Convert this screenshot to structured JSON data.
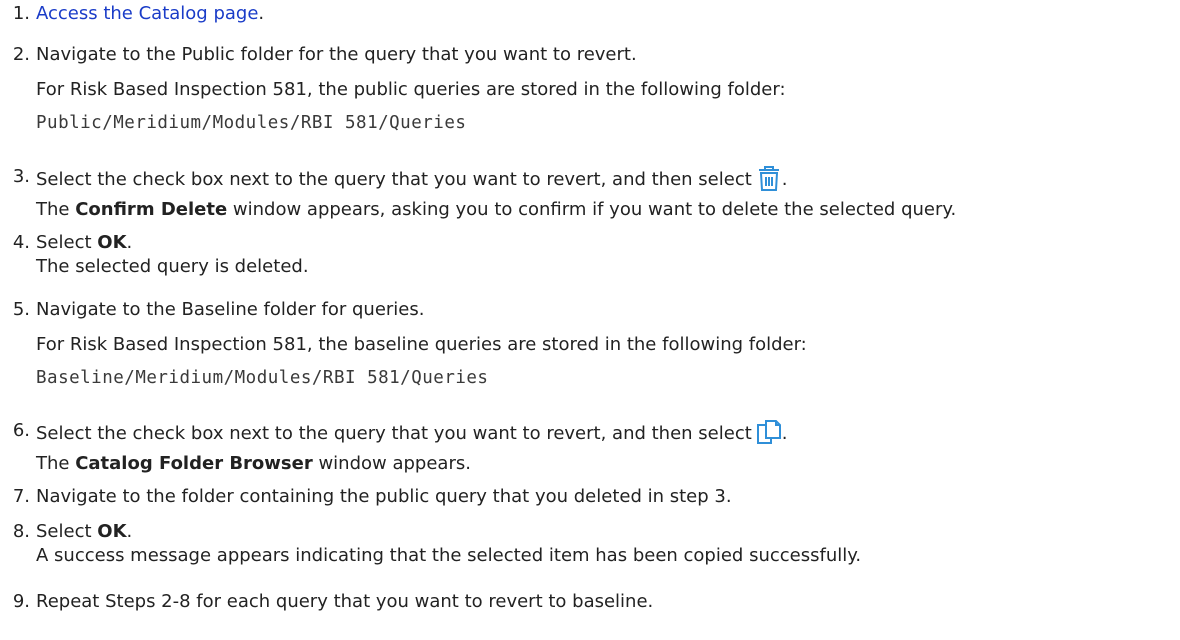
{
  "steps": [
    {
      "num": "1.",
      "link_text": "Access the Catalog page",
      "suffix": "."
    },
    {
      "num": "2.",
      "text": "Navigate to the Public folder for the query that you want to revert.",
      "note": "For Risk Based Inspection 581, the public queries are stored in the following folder:",
      "path": "Public/Meridium/Modules/RBI 581/Queries"
    },
    {
      "num": "3.",
      "text": "Select the check box next to the query that you want to revert, and then select",
      "icon": "trash-icon",
      "result_pre": "The ",
      "result_bold": "Confirm Delete",
      "result_post": " window appears, asking you to confirm if you want to delete the selected query."
    },
    {
      "num": "4.",
      "pre": "Select ",
      "bold": "OK",
      "post": ".",
      "result": "The selected query is deleted."
    },
    {
      "num": "5.",
      "text": "Navigate to the Baseline folder for queries.",
      "note": "For Risk Based Inspection 581, the baseline queries are stored in the following folder:",
      "path": "Baseline/Meridium/Modules/RBI 581/Queries"
    },
    {
      "num": "6.",
      "text": "Select the check box next to the query that you want to revert, and then select",
      "icon": "copy-icon",
      "result_pre": "The ",
      "result_bold": "Catalog Folder Browser",
      "result_post": " window appears."
    },
    {
      "num": "7.",
      "text": "Navigate to the folder containing the public query that you deleted in step 3."
    },
    {
      "num": "8.",
      "pre": "Select ",
      "bold": "OK",
      "post": ".",
      "result": "A success message appears indicating that the selected item has been copied successfully."
    },
    {
      "num": "9.",
      "text": "Repeat Steps 2-8 for each query that you want to revert to baseline."
    }
  ],
  "colors": {
    "link": "#1a3cc8",
    "icon": "#2f8fd8",
    "text": "#222222"
  }
}
